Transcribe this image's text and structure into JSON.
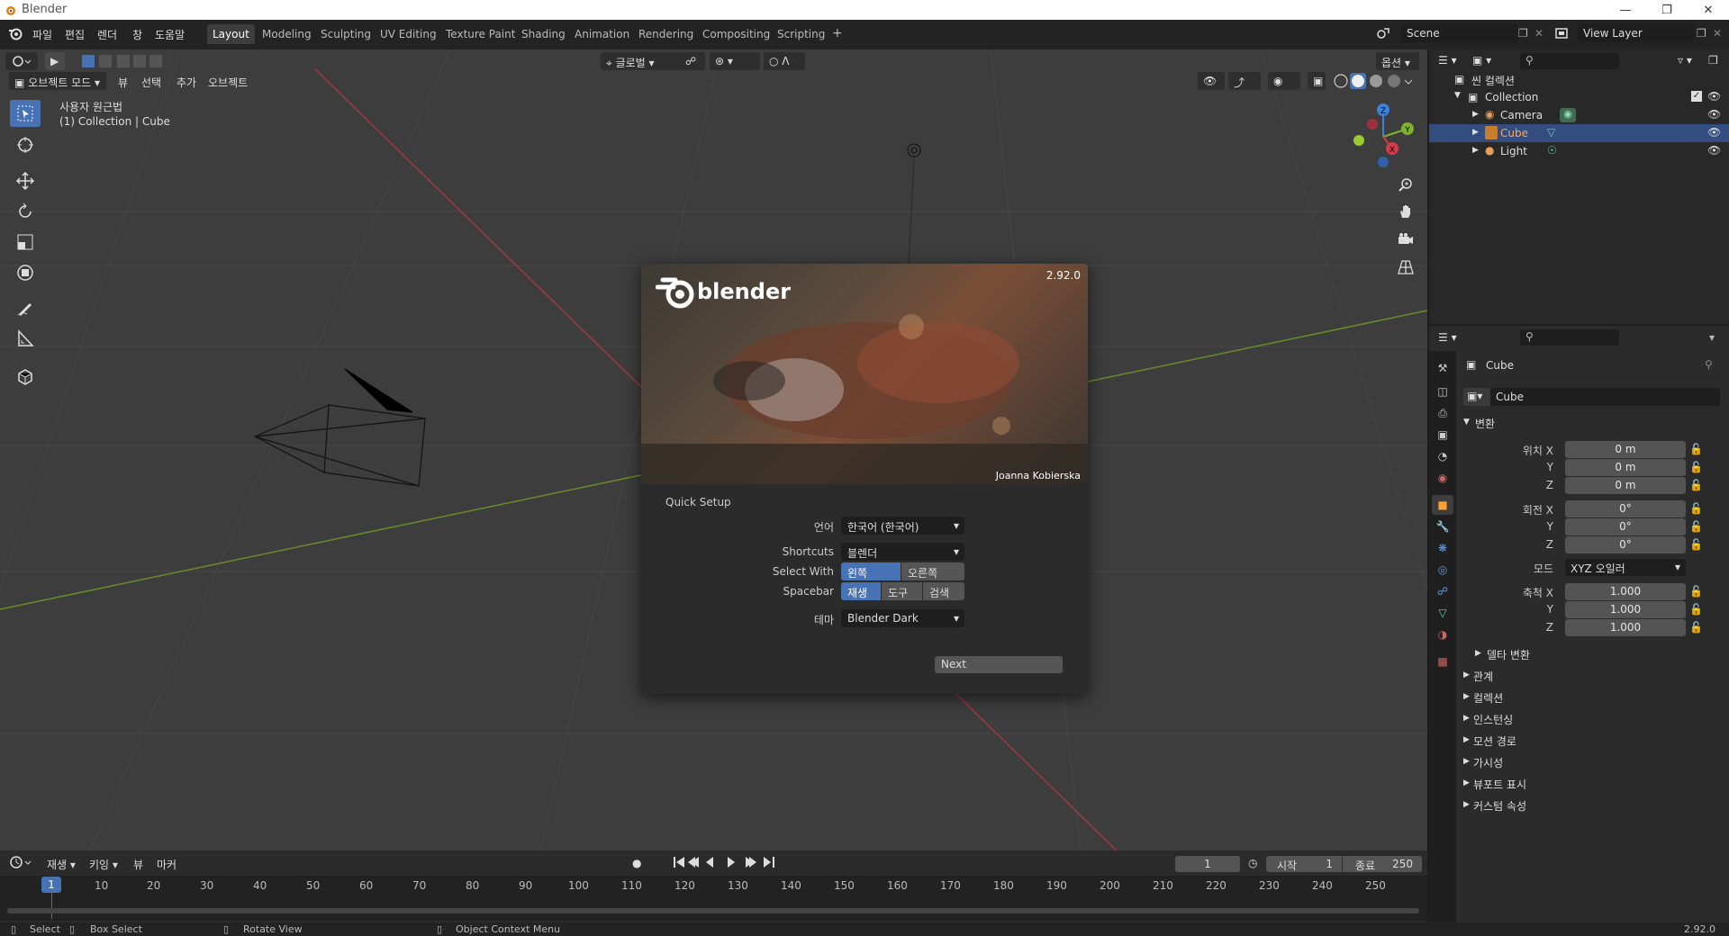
{
  "window": {
    "title": "Blender"
  },
  "menu": [
    "파일",
    "편집",
    "렌더",
    "창",
    "도움말"
  ],
  "workspaces": [
    "Layout",
    "Modeling",
    "Sculpting",
    "UV Editing",
    "Texture Paint",
    "Shading",
    "Animation",
    "Rendering",
    "Compositing",
    "Scripting"
  ],
  "scene": {
    "name": "Scene",
    "view_layer": "View Layer"
  },
  "viewport": {
    "mode": "오브젝트 모드",
    "menus": [
      "뷰",
      "선택",
      "추가",
      "오브젝트"
    ],
    "orientation": "글로벌",
    "options": "옵션",
    "info_line1": "사용자 원근법",
    "info_line2": "(1) Collection | Cube",
    "gizmo": {
      "x": "X",
      "y": "Y",
      "z": "Z"
    }
  },
  "splash": {
    "version": "2.92.0",
    "logo_text": "blender",
    "credit": "Joanna Kobierska",
    "section": "Quick Setup",
    "language_label": "언어",
    "language_value": "한국어 (한국어)",
    "shortcuts_label": "Shortcuts",
    "shortcuts_value": "블렌더",
    "select_label": "Select With",
    "select_left": "왼쪽",
    "select_right": "오른쪽",
    "spacebar_label": "Spacebar",
    "spacebar_play": "재생",
    "spacebar_tools": "도구",
    "spacebar_search": "검색",
    "theme_label": "테마",
    "theme_value": "Blender Dark",
    "next": "Next"
  },
  "timeline": {
    "menus": [
      "재생",
      "키잉",
      "뷰",
      "마커"
    ],
    "current_frame": "1",
    "start_label": "시작",
    "start": "1",
    "end_label": "종료",
    "end": "250",
    "ticks": [
      "1",
      "10",
      "20",
      "30",
      "40",
      "50",
      "60",
      "70",
      "80",
      "90",
      "100",
      "110",
      "120",
      "130",
      "140",
      "150",
      "160",
      "170",
      "180",
      "190",
      "200",
      "210",
      "220",
      "230",
      "240",
      "250"
    ]
  },
  "outliner": {
    "root": "씬 컬렉션",
    "collection": "Collection",
    "items": [
      {
        "name": "Camera"
      },
      {
        "name": "Cube"
      },
      {
        "name": "Light"
      }
    ]
  },
  "properties": {
    "object_name": "Cube",
    "data_name": "Cube",
    "transform": "변환",
    "location_label": "위치 X",
    "loc": [
      "0 m",
      "0 m",
      "0 m"
    ],
    "rotation_label": "회전 X",
    "rot": [
      "0°",
      "0°",
      "0°"
    ],
    "mode_label": "모드",
    "mode_value": "XYZ 오일러",
    "scale_label": "축척 X",
    "scale": [
      "1.000",
      "1.000",
      "1.000"
    ],
    "y": "Y",
    "z": "Z",
    "delta": "델타 변환",
    "sections": [
      "관계",
      "컬렉션",
      "인스턴싱",
      "모션 경로",
      "가시성",
      "뷰포트 표시",
      "커스텀 속성"
    ]
  },
  "status": {
    "select": "Select",
    "box_select": "Box Select",
    "rotate": "Rotate View",
    "context": "Object Context Menu",
    "version": "2.92.0"
  },
  "colors": {
    "accent": "#4772b3",
    "x_axis": "#d43a4b",
    "y_axis": "#7fb32d",
    "z_axis": "#3c82dc"
  }
}
